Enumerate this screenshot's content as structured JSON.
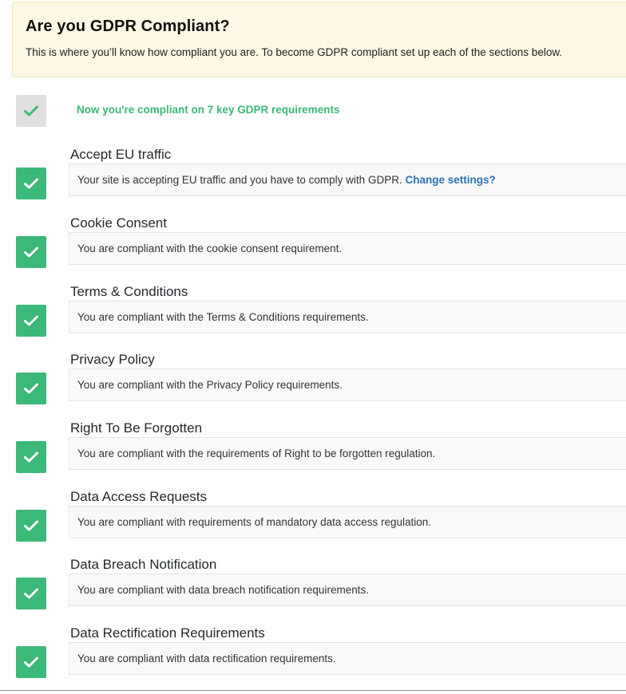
{
  "banner": {
    "title": "Are you GDPR Compliant?",
    "description": "This is where you’ll know how compliant you are. To become GDPR compliant set up each of the sections below.",
    "background_color": "#fcf8e3"
  },
  "summary": {
    "icon": "check-icon",
    "text": "Now you're compliant on 7 key GDPR requirements",
    "text_color": "#3cb878"
  },
  "requirements": [
    {
      "title": "Accept EU traffic",
      "description": "Your site is accepting EU traffic and you have to comply with GDPR.",
      "link_label": "Change settings?",
      "status_icon": "check-icon"
    },
    {
      "title": "Cookie Consent",
      "description": "You are compliant with the cookie consent requirement.",
      "status_icon": "check-icon"
    },
    {
      "title": "Terms & Conditions",
      "description": "You are compliant with the Terms & Conditions requirements.",
      "status_icon": "check-icon"
    },
    {
      "title": "Privacy Policy",
      "description": "You are compliant with the Privacy Policy requirements.",
      "status_icon": "check-icon"
    },
    {
      "title": "Right To Be Forgotten",
      "description": "You are compliant with the requirements of Right to be forgotten regulation.",
      "status_icon": "check-icon"
    },
    {
      "title": "Data Access Requests",
      "description": "You are compliant with requirements of mandatory data access regulation.",
      "status_icon": "check-icon"
    },
    {
      "title": "Data Breach Notification",
      "description": "You are compliant with data breach notification requirements.",
      "status_icon": "check-icon"
    },
    {
      "title": "Data Rectification Requirements",
      "description": "You are compliant with data rectification requirements.",
      "status_icon": "check-icon"
    }
  ],
  "colors": {
    "success": "#3cb878",
    "link": "#2a72b5",
    "neutral_check_bg": "#e0dfdf"
  }
}
